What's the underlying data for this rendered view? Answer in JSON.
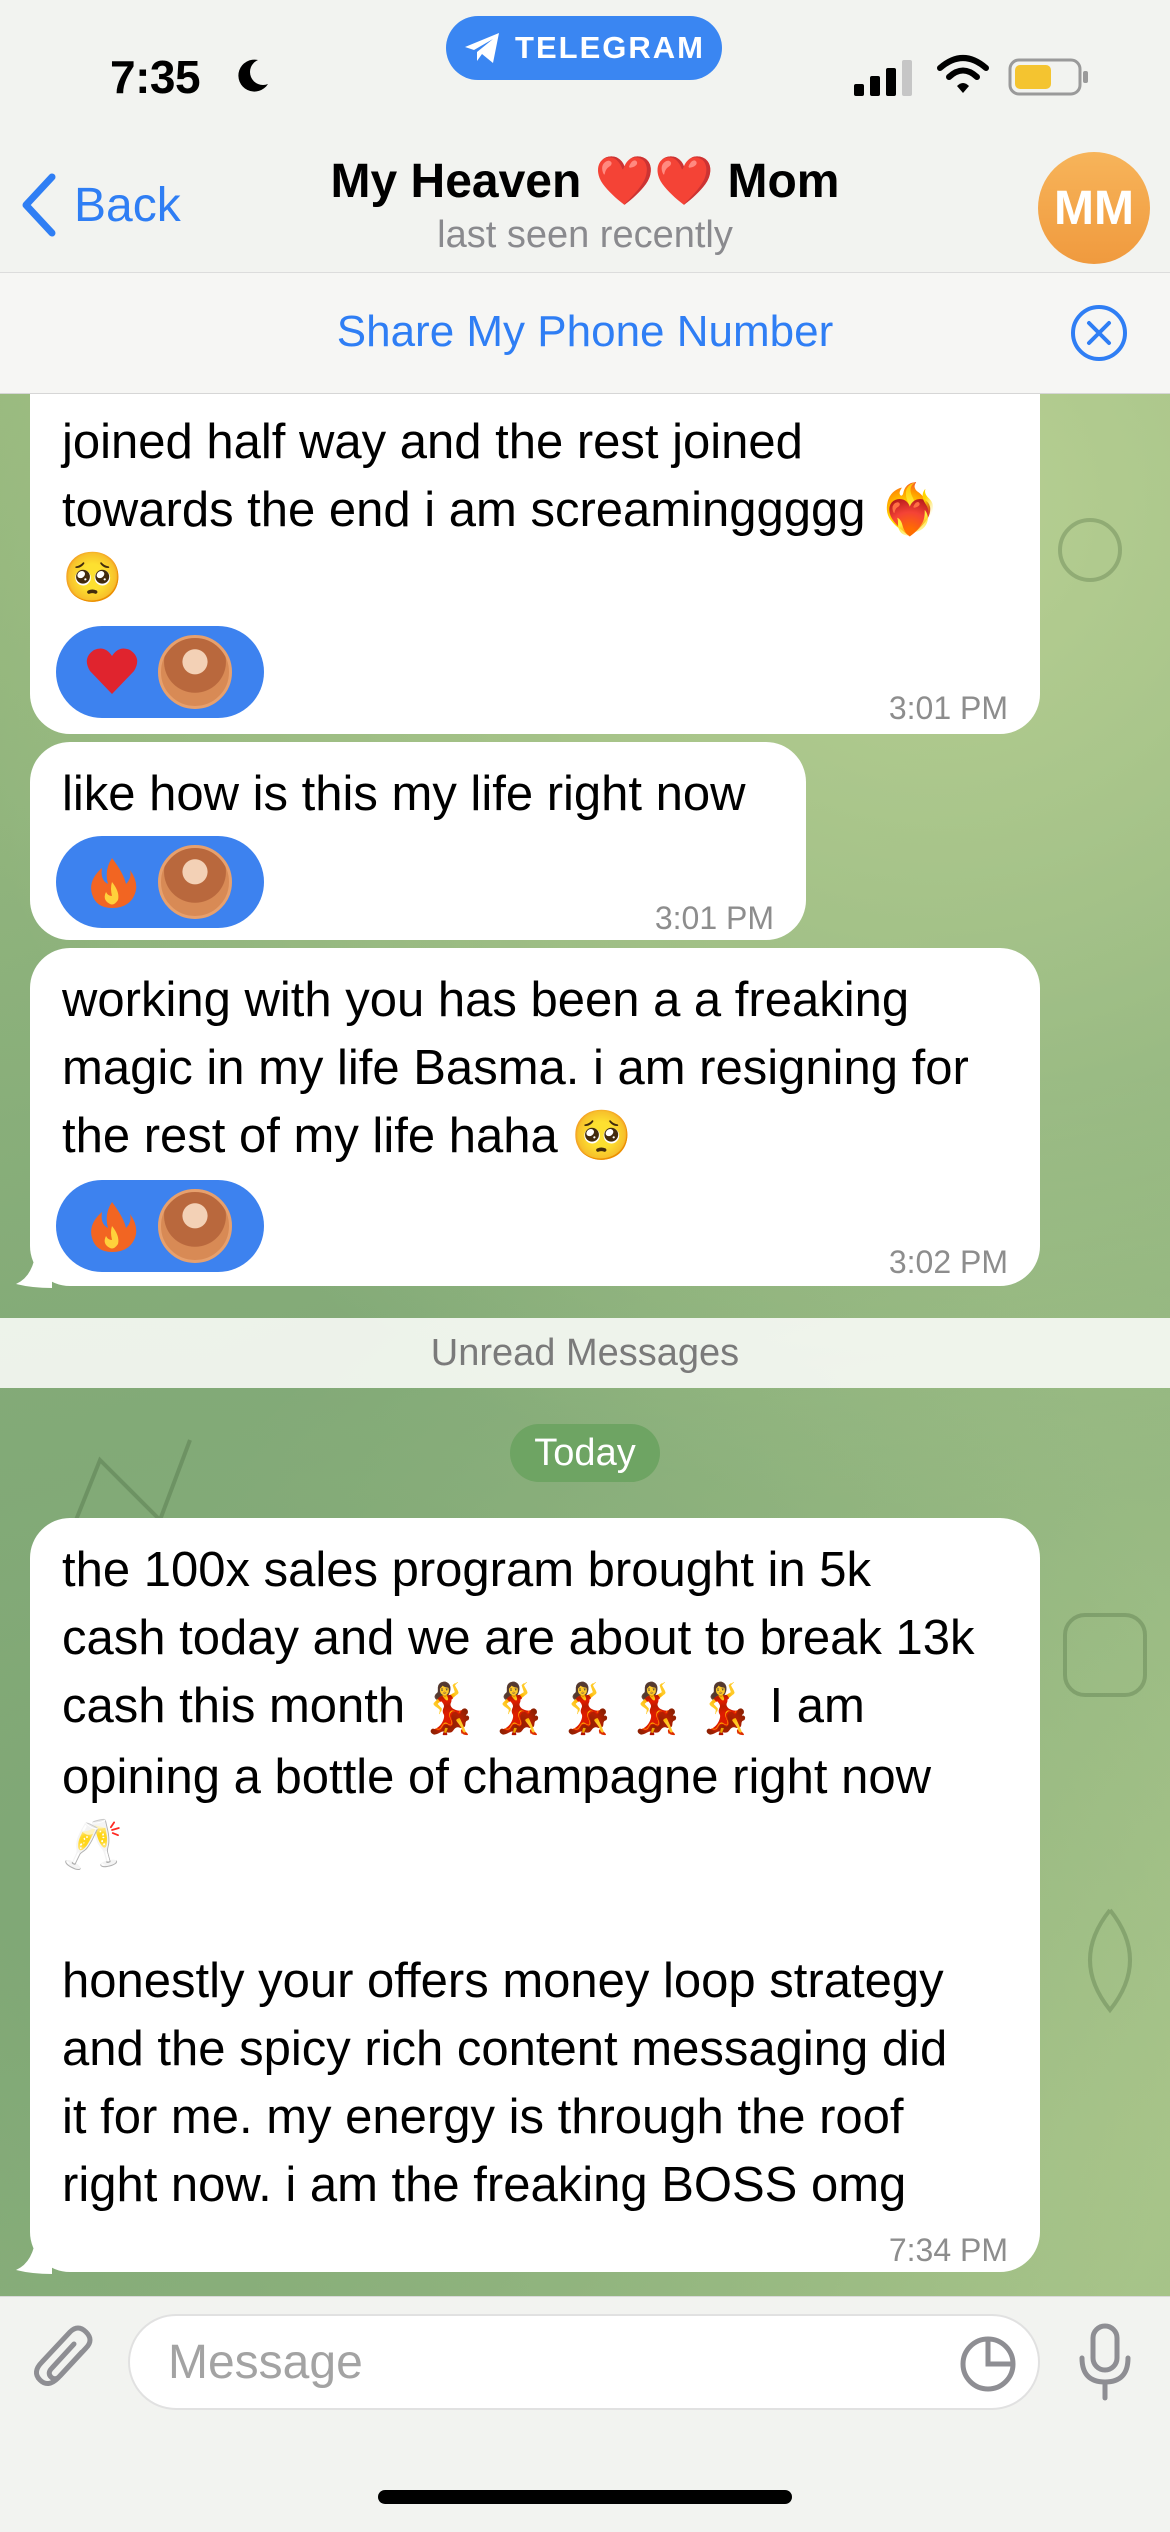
{
  "status_bar": {
    "time": "7:35",
    "app_badge": "TELEGRAM"
  },
  "header": {
    "back_label": "Back",
    "title": "My Heaven ❤️❤️ Mom",
    "subtitle": "last seen recently",
    "avatar_initials": "MM"
  },
  "share_bar": {
    "label": "Share My Phone Number"
  },
  "messages": [
    {
      "text": "joined half way and the rest joined\ntowards the end i am screaminggggg ❤️‍🔥\n🥺",
      "time": "3:01 PM",
      "reaction": "heart"
    },
    {
      "text": "like how is this my life right now",
      "time": "3:01 PM",
      "reaction": "fire"
    },
    {
      "text": "working with you has been a a freaking\nmagic in my life Basma. i am resigning for\nthe rest of my life haha 🥺",
      "time": "3:02 PM",
      "reaction": "fire"
    },
    {
      "text_before_icons": "the 100x sales program brought in 5k\ncash today and we are about to break 13k\ncash this month ",
      "inline_emoji": "💃",
      "text_after_icons": " I am\nopining a bottle of champagne right now\n🥂\n\nhonestly your offers money loop strategy\nand the spicy rich content messaging did\nit for me. my energy is through the roof\nright now. i am the freaking BOSS omg",
      "time": "7:34 PM"
    }
  ],
  "unread_label": "Unread Messages",
  "date_label": "Today",
  "composer": {
    "placeholder": "Message"
  },
  "colors": {
    "accent": "#2f7ef4",
    "reaction_bg": "#3d82ef",
    "avatar_bg": "#f5a84c",
    "date_chip": "#6ea463"
  },
  "icons": [
    "moon-icon",
    "telegram-icon",
    "signal-icon",
    "wifi-icon",
    "battery-icon",
    "back-chevron-icon",
    "close-circle-icon",
    "heart-icon",
    "fire-icon",
    "attach-icon",
    "sticker-icon",
    "microphone-icon"
  ]
}
